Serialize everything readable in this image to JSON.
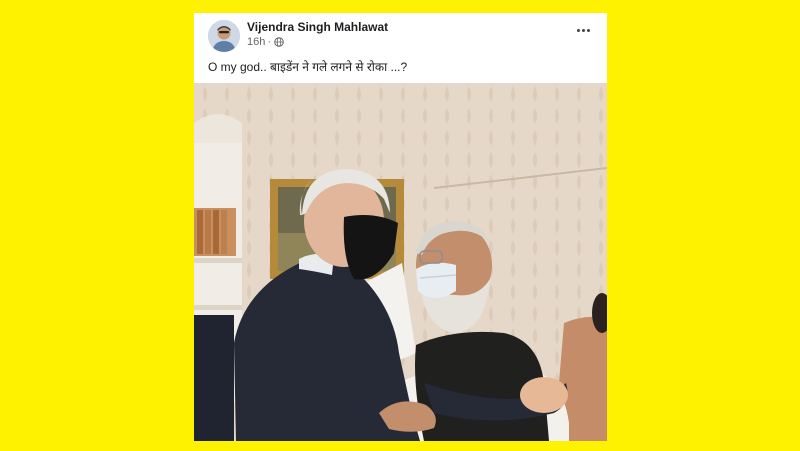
{
  "post": {
    "author": "Vijendra Singh Mahlawat",
    "time": "16h",
    "separator": "·",
    "privacy_icon": "globe-icon",
    "more_icon": "more-options-icon",
    "caption": "O my god.. बाइडेंन ने गले लगने से रोका ...?"
  },
  "colors": {
    "background": "#FFF200",
    "card": "#ffffff",
    "meta_text": "#65676b"
  }
}
